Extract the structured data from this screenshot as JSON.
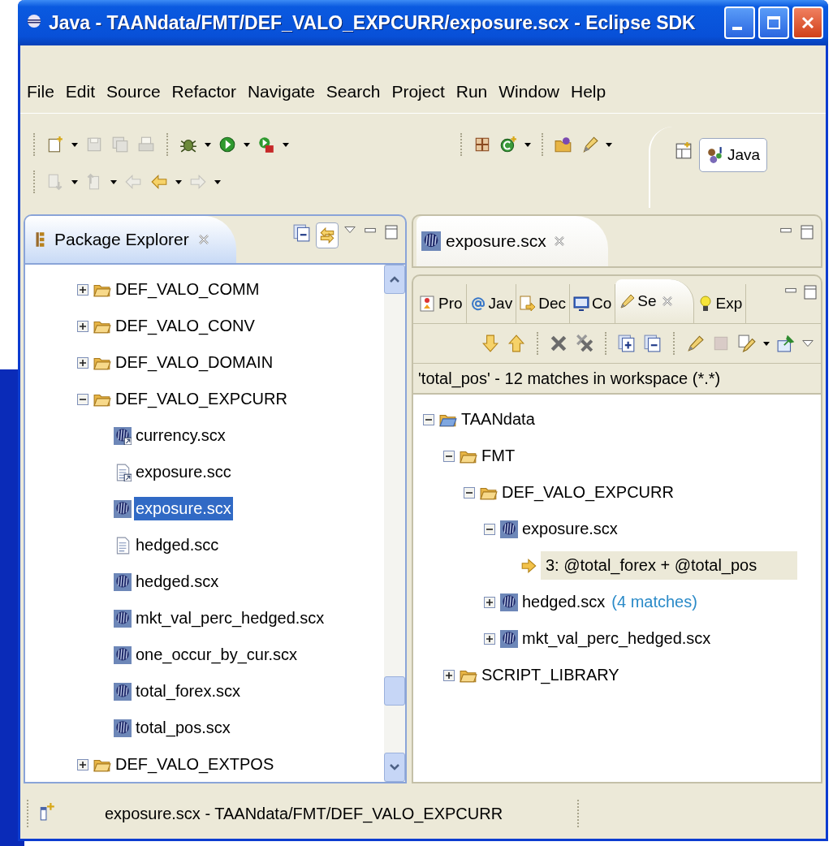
{
  "window": {
    "title": "Java - TAANdata/FMT/DEF_VALO_EXPCURR/exposure.scx - Eclipse SDK"
  },
  "menu": [
    "File",
    "Edit",
    "Source",
    "Refactor",
    "Navigate",
    "Search",
    "Project",
    "Run",
    "Window",
    "Help"
  ],
  "perspectives": [
    {
      "label": "Java",
      "selected": true
    }
  ],
  "package_explorer": {
    "title": "Package Explorer",
    "items": [
      {
        "label": "DEF_VALO_COMM",
        "kind": "folder",
        "expanded": false,
        "selected": false
      },
      {
        "label": "DEF_VALO_CONV",
        "kind": "folder",
        "expanded": false,
        "selected": false
      },
      {
        "label": "DEF_VALO_DOMAIN",
        "kind": "folder",
        "expanded": false,
        "selected": false
      },
      {
        "label": "DEF_VALO_EXPCURR",
        "kind": "folder",
        "expanded": true,
        "selected": false,
        "children": [
          {
            "label": "currency.scx",
            "kind": "scx-shortcut",
            "selected": false
          },
          {
            "label": "exposure.scc",
            "kind": "scc-shortcut",
            "selected": false
          },
          {
            "label": "exposure.scx",
            "kind": "scx",
            "selected": true
          },
          {
            "label": "hedged.scc",
            "kind": "scc",
            "selected": false
          },
          {
            "label": "hedged.scx",
            "kind": "scx",
            "selected": false
          },
          {
            "label": "mkt_val_perc_hedged.scx",
            "kind": "scx",
            "selected": false
          },
          {
            "label": "one_occur_by_cur.scx",
            "kind": "scx",
            "selected": false
          },
          {
            "label": "total_forex.scx",
            "kind": "scx",
            "selected": false
          },
          {
            "label": "total_pos.scx",
            "kind": "scx",
            "selected": false
          }
        ]
      },
      {
        "label": "DEF_VALO_EXTPOS",
        "kind": "folder",
        "expanded": false,
        "selected": false
      }
    ]
  },
  "editor": {
    "tabs": [
      {
        "label": "exposure.scx",
        "selected": true
      }
    ]
  },
  "views": {
    "tabs": [
      {
        "label": "Pro",
        "selected": false
      },
      {
        "label": "Jav",
        "selected": false
      },
      {
        "label": "Dec",
        "selected": false
      },
      {
        "label": "Co",
        "selected": false
      },
      {
        "label": "Se",
        "selected": true
      },
      {
        "label": "Exp",
        "selected": false
      }
    ],
    "search": {
      "summary": "'total_pos' - 12 matches in workspace (*.*)",
      "items": [
        {
          "label": "TAANdata",
          "kind": "project",
          "expanded": true,
          "selected": false,
          "children": [
            {
              "label": "FMT",
              "kind": "folder",
              "expanded": true,
              "selected": false,
              "children": [
                {
                  "label": "DEF_VALO_EXPCURR",
                  "kind": "folder",
                  "expanded": true,
                  "selected": false,
                  "children": [
                    {
                      "label": "exposure.scx",
                      "kind": "scx",
                      "expanded": true,
                      "selected": false,
                      "children": [
                        {
                          "label": "3: @total_forex + @total_pos",
                          "kind": "match",
                          "selected": true
                        }
                      ]
                    },
                    {
                      "label": "hedged.scx",
                      "count": "(4 matches)",
                      "kind": "scx",
                      "expanded": false,
                      "selected": false
                    },
                    {
                      "label": "mkt_val_perc_hedged.scx",
                      "kind": "scx",
                      "expanded": false,
                      "selected": false
                    }
                  ]
                }
              ]
            },
            {
              "label": "SCRIPT_LIBRARY",
              "kind": "folder",
              "expanded": false,
              "selected": false
            }
          ]
        }
      ]
    }
  },
  "status_bar": {
    "text": "exposure.scx - TAANdata/FMT/DEF_VALO_EXPCURR"
  }
}
